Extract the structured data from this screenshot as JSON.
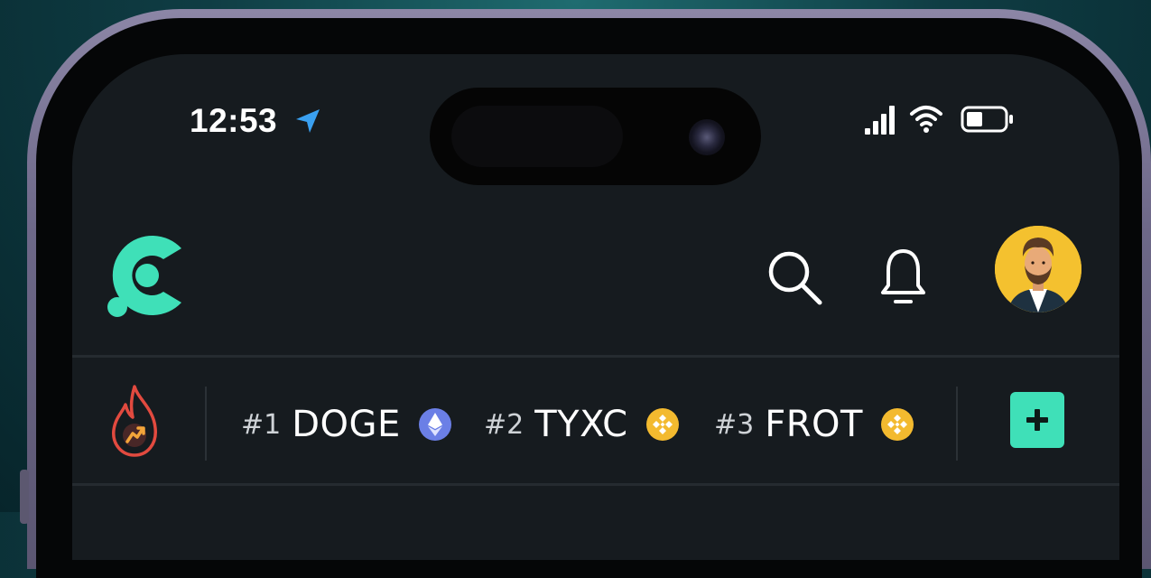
{
  "status_bar": {
    "time": "12:53",
    "icons": [
      "location-arrow-icon",
      "cellular-signal-icon",
      "wifi-icon",
      "battery-icon"
    ]
  },
  "header": {
    "logo": "app-logo",
    "actions": [
      "search-icon",
      "bell-icon",
      "avatar"
    ]
  },
  "trending": {
    "items": [
      {
        "rank": "#1",
        "symbol": "DOGE",
        "chain_icon": "ethereum-icon"
      },
      {
        "rank": "#2",
        "symbol": "TYXC",
        "chain_icon": "bnb-icon"
      },
      {
        "rank": "#3",
        "symbol": "FROT",
        "chain_icon": "bnb-icon"
      }
    ],
    "add_button_icon": "plus-icon"
  },
  "colors": {
    "accent": "#3fe0b8",
    "background": "#161b1f",
    "fire": "#e24a3f",
    "ethereum": "#6b7fe6",
    "bnb": "#f3ba2f",
    "location": "#3aa0f0"
  }
}
